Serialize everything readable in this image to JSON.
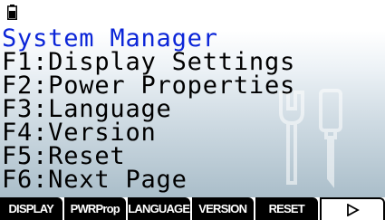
{
  "statusbar": {
    "battery_icon": "battery-icon"
  },
  "menu": {
    "title": "System Manager",
    "items": [
      {
        "label": "F1:Display Settings"
      },
      {
        "label": "F2:Power Properties"
      },
      {
        "label": "F3:Language"
      },
      {
        "label": "F4:Version"
      },
      {
        "label": "F5:Reset"
      },
      {
        "label": "F6:Next Page"
      }
    ]
  },
  "watermark_icon": "tools-icon",
  "fkeys": [
    {
      "label": "DISPLAY"
    },
    {
      "label": "PWRProp"
    },
    {
      "label": "LANGUAGE"
    },
    {
      "label": "VERSION"
    },
    {
      "label": "RESET"
    },
    {
      "label": "",
      "icon": "right-arrow-icon"
    }
  ],
  "colors": {
    "title": "#0b25d8",
    "fkey_bg": "#000000"
  }
}
